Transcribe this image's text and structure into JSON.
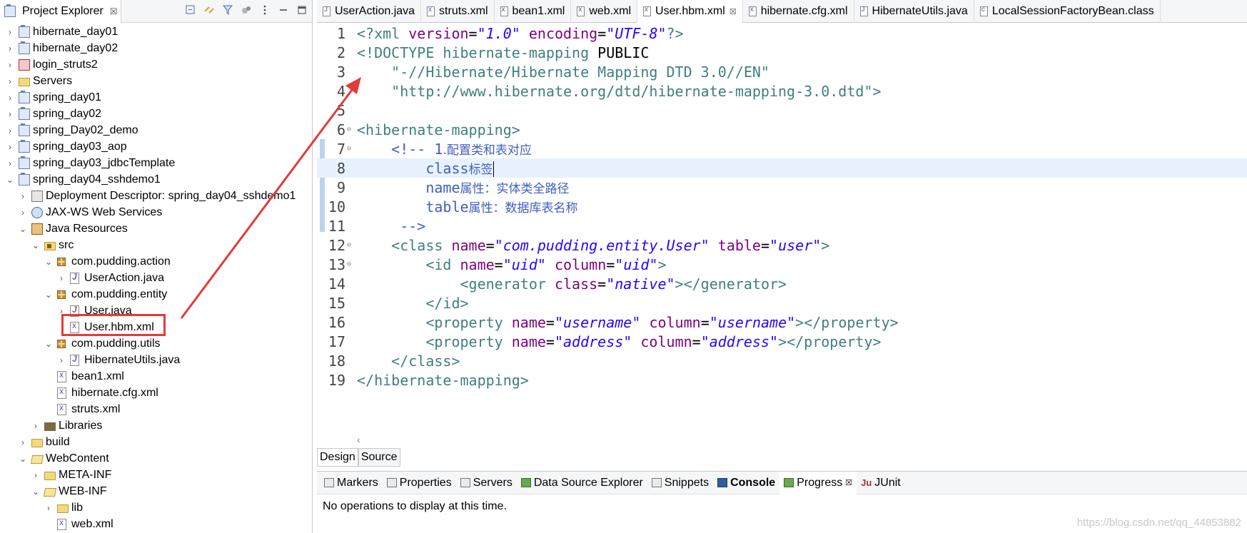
{
  "explorer": {
    "title": "Project Explorer",
    "close": "☒",
    "items": [
      {
        "label": "hibernate_day01",
        "twisty": "›",
        "icon": "project-icon",
        "level": 0
      },
      {
        "label": "hibernate_day02",
        "twisty": "›",
        "icon": "project-icon",
        "level": 0
      },
      {
        "label": "login_struts2",
        "twisty": "›",
        "icon": "project-error-icon",
        "level": 0
      },
      {
        "label": "Servers",
        "twisty": "›",
        "icon": "folder-icon",
        "level": 0
      },
      {
        "label": "spring_day01",
        "twisty": "›",
        "icon": "project-icon",
        "level": 0
      },
      {
        "label": "spring_day02",
        "twisty": "›",
        "icon": "project-icon",
        "level": 0
      },
      {
        "label": "spring_Day02_demo",
        "twisty": "›",
        "icon": "project-icon",
        "level": 0
      },
      {
        "label": "spring_day03_aop",
        "twisty": "›",
        "icon": "project-icon",
        "level": 0
      },
      {
        "label": "spring_day03_jdbcTemplate",
        "twisty": "›",
        "icon": "project-icon",
        "level": 0
      },
      {
        "label": "spring_day04_sshdemo1",
        "twisty": "⌄",
        "icon": "project-icon",
        "level": 0
      },
      {
        "label": "Deployment Descriptor: spring_day04_sshdemo1",
        "twisty": "›",
        "icon": "deployment-descriptor-icon",
        "level": 1
      },
      {
        "label": "JAX-WS Web Services",
        "twisty": "›",
        "icon": "web-services-icon",
        "level": 1
      },
      {
        "label": "Java Resources",
        "twisty": "⌄",
        "icon": "java-resources-icon",
        "level": 1
      },
      {
        "label": "src",
        "twisty": "⌄",
        "icon": "source-folder-icon",
        "level": 2
      },
      {
        "label": "com.pudding.action",
        "twisty": "⌄",
        "icon": "package-icon",
        "level": 3
      },
      {
        "label": "UserAction.java",
        "twisty": "›",
        "icon": "java-file-icon",
        "level": 4
      },
      {
        "label": "com.pudding.entity",
        "twisty": "⌄",
        "icon": "package-icon",
        "level": 3
      },
      {
        "label": "User.java",
        "twisty": "›",
        "icon": "java-file-icon",
        "level": 4
      },
      {
        "label": "User.hbm.xml",
        "twisty": "",
        "icon": "xml-file-icon",
        "level": 4
      },
      {
        "label": "com.pudding.utils",
        "twisty": "⌄",
        "icon": "package-icon",
        "level": 3
      },
      {
        "label": "HibernateUtils.java",
        "twisty": "›",
        "icon": "java-file-icon",
        "level": 4
      },
      {
        "label": "bean1.xml",
        "twisty": "",
        "icon": "xml-file-icon",
        "level": 3
      },
      {
        "label": "hibernate.cfg.xml",
        "twisty": "",
        "icon": "xml-file-icon",
        "level": 3
      },
      {
        "label": "struts.xml",
        "twisty": "",
        "icon": "xml-file-icon",
        "level": 3
      },
      {
        "label": "Libraries",
        "twisty": "›",
        "icon": "libraries-icon",
        "level": 2
      },
      {
        "label": "build",
        "twisty": "›",
        "icon": "folder-icon",
        "level": 1
      },
      {
        "label": "WebContent",
        "twisty": "⌄",
        "icon": "folder-open-icon",
        "level": 1
      },
      {
        "label": "META-INF",
        "twisty": "›",
        "icon": "folder-icon",
        "level": 2
      },
      {
        "label": "WEB-INF",
        "twisty": "⌄",
        "icon": "folder-open-icon",
        "level": 2
      },
      {
        "label": "lib",
        "twisty": "›",
        "icon": "folder-icon",
        "level": 3
      },
      {
        "label": "web.xml",
        "twisty": "",
        "icon": "xml-file-icon",
        "level": 3
      }
    ]
  },
  "editor_tabs": [
    {
      "label": "UserAction.java",
      "glyph": "J",
      "active": false
    },
    {
      "label": "struts.xml",
      "glyph": "x",
      "active": false
    },
    {
      "label": "bean1.xml",
      "glyph": "x",
      "active": false
    },
    {
      "label": "web.xml",
      "glyph": "x",
      "active": false
    },
    {
      "label": "User.hbm.xml",
      "glyph": "x",
      "active": true,
      "close": "☒"
    },
    {
      "label": "hibernate.cfg.xml",
      "glyph": "x",
      "active": false
    },
    {
      "label": "HibernateUtils.java",
      "glyph": "J",
      "active": false
    },
    {
      "label": "LocalSessionFactoryBean.class",
      "glyph": "c",
      "active": false
    }
  ],
  "code": {
    "current_line": 8,
    "lines": [
      {
        "n": "1",
        "fold": "",
        "tokens": [
          [
            "pi",
            "<?xml "
          ],
          [
            "attr",
            "version"
          ],
          [
            "plain",
            "="
          ],
          [
            "str",
            "\"1.0\""
          ],
          [
            "plain",
            " "
          ],
          [
            "attr",
            "encoding"
          ],
          [
            "plain",
            "="
          ],
          [
            "str",
            "\"UTF-8\""
          ],
          [
            "pi",
            "?>"
          ]
        ]
      },
      {
        "n": "2",
        "fold": "",
        "tokens": [
          [
            "dtd",
            "<!DOCTYPE hibernate-mapping "
          ],
          [
            "plain",
            "PUBLIC"
          ]
        ]
      },
      {
        "n": "3",
        "fold": "",
        "tokens": [
          [
            "plain",
            "    "
          ],
          [
            "dstr",
            "\"-//Hibernate/Hibernate Mapping DTD 3.0//EN\""
          ]
        ]
      },
      {
        "n": "4",
        "fold": "",
        "tokens": [
          [
            "plain",
            "    "
          ],
          [
            "dstr",
            "\"http://www.hibernate.org/dtd/hibernate-mapping-3.0.dtd\""
          ],
          [
            "dtd",
            ">"
          ]
        ]
      },
      {
        "n": "5",
        "fold": "",
        "tokens": []
      },
      {
        "n": "6",
        "fold": "⊖",
        "tokens": [
          [
            "tag",
            "<hibernate-mapping>"
          ]
        ]
      },
      {
        "n": "7",
        "fold": "⊖",
        "tokens": [
          [
            "plain",
            "    "
          ],
          [
            "cmt",
            "<!-- 1"
          ],
          [
            "cjk",
            "."
          ],
          [
            "cjk",
            "配置类和表对应"
          ]
        ]
      },
      {
        "n": "8",
        "fold": "",
        "tokens": [
          [
            "plain",
            "        "
          ],
          [
            "cmt",
            "class"
          ],
          [
            "cjk",
            "标签"
          ],
          [
            "caret",
            ""
          ]
        ]
      },
      {
        "n": "9",
        "fold": "",
        "tokens": [
          [
            "plain",
            "        "
          ],
          [
            "cmt",
            "name"
          ],
          [
            "cjk",
            "属性：实体类全路径"
          ]
        ]
      },
      {
        "n": "10",
        "fold": "",
        "tokens": [
          [
            "plain",
            "        "
          ],
          [
            "cmt",
            "table"
          ],
          [
            "cjk",
            "属性：数据库表名称"
          ]
        ]
      },
      {
        "n": "11",
        "fold": "",
        "tokens": [
          [
            "plain",
            "     "
          ],
          [
            "cmt",
            "-->"
          ]
        ]
      },
      {
        "n": "12",
        "fold": "⊖",
        "tokens": [
          [
            "plain",
            "    "
          ],
          [
            "tag",
            "<class "
          ],
          [
            "attr",
            "name"
          ],
          [
            "plain",
            "="
          ],
          [
            "str",
            "\"com.pudding.entity.User\""
          ],
          [
            "plain",
            " "
          ],
          [
            "attr",
            "table"
          ],
          [
            "plain",
            "="
          ],
          [
            "str",
            "\"user\""
          ],
          [
            "tag",
            ">"
          ]
        ]
      },
      {
        "n": "13",
        "fold": "⊖",
        "tokens": [
          [
            "plain",
            "        "
          ],
          [
            "tag",
            "<id "
          ],
          [
            "attr",
            "name"
          ],
          [
            "plain",
            "="
          ],
          [
            "str",
            "\"uid\""
          ],
          [
            "plain",
            " "
          ],
          [
            "attr",
            "column"
          ],
          [
            "plain",
            "="
          ],
          [
            "str",
            "\"uid\""
          ],
          [
            "tag",
            ">"
          ]
        ]
      },
      {
        "n": "14",
        "fold": "",
        "tokens": [
          [
            "plain",
            "            "
          ],
          [
            "tag",
            "<generator "
          ],
          [
            "attr",
            "class"
          ],
          [
            "plain",
            "="
          ],
          [
            "str",
            "\"native\""
          ],
          [
            "tag",
            "></generator>"
          ]
        ]
      },
      {
        "n": "15",
        "fold": "",
        "tokens": [
          [
            "plain",
            "        "
          ],
          [
            "tag",
            "</id>"
          ]
        ]
      },
      {
        "n": "16",
        "fold": "",
        "tokens": [
          [
            "plain",
            "        "
          ],
          [
            "tag",
            "<property "
          ],
          [
            "attr",
            "name"
          ],
          [
            "plain",
            "="
          ],
          [
            "str",
            "\"username\""
          ],
          [
            "plain",
            " "
          ],
          [
            "attr",
            "column"
          ],
          [
            "plain",
            "="
          ],
          [
            "str",
            "\"username\""
          ],
          [
            "tag",
            "></property>"
          ]
        ]
      },
      {
        "n": "17",
        "fold": "",
        "tokens": [
          [
            "plain",
            "        "
          ],
          [
            "tag",
            "<property "
          ],
          [
            "attr",
            "name"
          ],
          [
            "plain",
            "="
          ],
          [
            "str",
            "\"address\""
          ],
          [
            "plain",
            " "
          ],
          [
            "attr",
            "column"
          ],
          [
            "plain",
            "="
          ],
          [
            "str",
            "\"address\""
          ],
          [
            "tag",
            "></property>"
          ]
        ]
      },
      {
        "n": "18",
        "fold": "",
        "tokens": [
          [
            "plain",
            "    "
          ],
          [
            "tag",
            "</class>"
          ]
        ]
      },
      {
        "n": "19",
        "fold": "",
        "tokens": [
          [
            "tag",
            "</hibernate-mapping>"
          ]
        ]
      }
    ]
  },
  "design_source": {
    "design": "Design",
    "source": "Source"
  },
  "bottom_tabs": [
    {
      "label": "Markers",
      "icon": "markers-icon"
    },
    {
      "label": "Properties",
      "icon": "properties-icon"
    },
    {
      "label": "Servers",
      "icon": "servers-icon"
    },
    {
      "label": "Data Source Explorer",
      "icon": "data-source-icon"
    },
    {
      "label": "Snippets",
      "icon": "snippets-icon"
    },
    {
      "label": "Console",
      "icon": "console-icon"
    },
    {
      "label": "Progress",
      "icon": "progress-icon",
      "close": "☒"
    },
    {
      "label": "JUnit",
      "icon": "junit-icon"
    }
  ],
  "progress_message": "No operations to display at this time.",
  "watermark": "https://blog.csdn.net/qq_44853882",
  "scroll_glyph": "‹"
}
